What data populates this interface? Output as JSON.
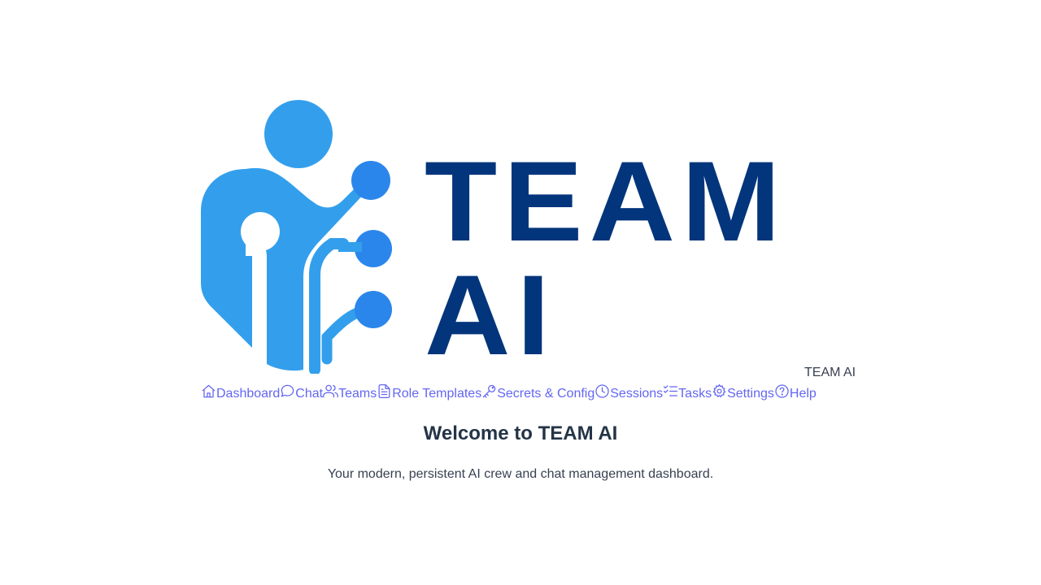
{
  "logo": {
    "line1": "TEAM",
    "line2": "AI",
    "alt": "TEAM AI",
    "colors": {
      "figure": "#339fec",
      "node": "#2b86eb",
      "wordmark": "#03357c"
    }
  },
  "nav": {
    "items": [
      {
        "label": "Dashboard",
        "icon": "home-icon"
      },
      {
        "label": "Chat",
        "icon": "chat-bubble-icon"
      },
      {
        "label": "Teams",
        "icon": "users-icon"
      },
      {
        "label": "Role Templates",
        "icon": "document-icon"
      },
      {
        "label": "Secrets & Config",
        "icon": "key-icon"
      },
      {
        "label": "Sessions",
        "icon": "clock-icon"
      },
      {
        "label": "Tasks",
        "icon": "checklist-icon"
      },
      {
        "label": "Settings",
        "icon": "gear-icon"
      },
      {
        "label": "Help",
        "icon": "help-circle-icon"
      }
    ],
    "link_color": "#6366f1"
  },
  "main": {
    "title": "Welcome to TEAM AI",
    "subtitle": "Your modern, persistent AI crew and chat management dashboard."
  }
}
